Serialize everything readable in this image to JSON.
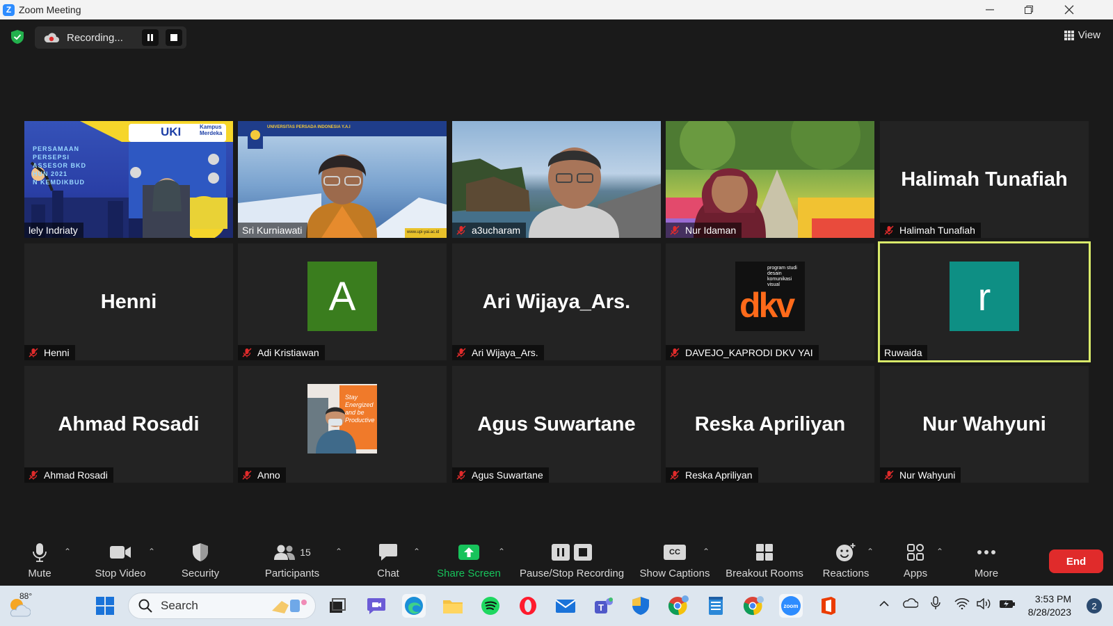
{
  "window": {
    "title": "Zoom Meeting"
  },
  "topbar": {
    "recording_label": "Recording...",
    "view_label": "View"
  },
  "participants": [
    {
      "name": "lely Indriaty",
      "muted": false,
      "type": "video"
    },
    {
      "name": "Sri Kurniawati",
      "muted": false,
      "type": "video"
    },
    {
      "name": "a3ucharam",
      "muted": true,
      "type": "video"
    },
    {
      "name": "Nur Idaman",
      "muted": true,
      "type": "video"
    },
    {
      "name": "Halimah Tunafiah",
      "display": "Halimah Tunafiah",
      "muted": true,
      "type": "name"
    },
    {
      "name": "Henni",
      "display": "Henni",
      "muted": true,
      "type": "name"
    },
    {
      "name": "Adi Kristiawan",
      "muted": true,
      "type": "avatar",
      "avatar_letter": "A",
      "avatar_color": "#3a7d1e"
    },
    {
      "name": "Ari Wijaya_Ars.",
      "display": "Ari Wijaya_Ars.",
      "muted": true,
      "type": "name"
    },
    {
      "name": "DAVEJO_KAPRODI DKV YAI",
      "muted": true,
      "type": "logo",
      "logo_text": "dkv",
      "logo_subtext": [
        "program studi",
        "desain",
        "komunikasi",
        "visual"
      ]
    },
    {
      "name": "Ruwaida",
      "muted": false,
      "type": "avatar",
      "avatar_letter": "r",
      "avatar_color": "#0e8f84",
      "active": true
    },
    {
      "name": "Ahmad Rosadi",
      "display": "Ahmad Rosadi",
      "muted": true,
      "type": "name"
    },
    {
      "name": "Anno",
      "muted": true,
      "type": "photo"
    },
    {
      "name": "Agus Suwartane",
      "display": "Agus Suwartane",
      "muted": true,
      "type": "name"
    },
    {
      "name": "Reska Apriliyan",
      "display": "Reska Apriliyan",
      "muted": true,
      "type": "name"
    },
    {
      "name": "Nur Wahyuni",
      "display": "Nur Wahyuni",
      "muted": true,
      "type": "name"
    }
  ],
  "tile_texts": {
    "uki": "UKI",
    "kampus_merdeka": "Kampus Merdeka",
    "persamaan_lines": [
      "PERSAMAAN",
      "PERSEPSI",
      "ASSESOR BKD",
      "HUN 2021",
      "N KEMDIKBUD"
    ],
    "univ_banner": "UNIVERSITAS PERSADA INDONESIA Y.A.I",
    "univ_url": "www.upi-yai.ac.id",
    "stay_text": [
      "Stay",
      "Energized",
      "and be",
      "Productive"
    ]
  },
  "toolbar": {
    "mute": "Mute",
    "stop_video": "Stop Video",
    "security": "Security",
    "participants": "Participants",
    "participants_count": "15",
    "chat": "Chat",
    "share_screen": "Share Screen",
    "pause_stop_recording": "Pause/Stop Recording",
    "show_captions": "Show Captions",
    "captions_badge": "CC",
    "breakout_rooms": "Breakout Rooms",
    "reactions": "Reactions",
    "apps": "Apps",
    "more": "More",
    "end": "End"
  },
  "taskbar": {
    "temperature": "88°",
    "search_label": "Search",
    "time": "3:53 PM",
    "date": "8/28/2023",
    "notification_count": "2",
    "zoom_icon_text": "zoom"
  },
  "colors": {
    "active_outline": "#d9ea6a",
    "end_button": "#e02b2b",
    "share_green": "#17c35b",
    "recording_red": "#e02b2b"
  }
}
